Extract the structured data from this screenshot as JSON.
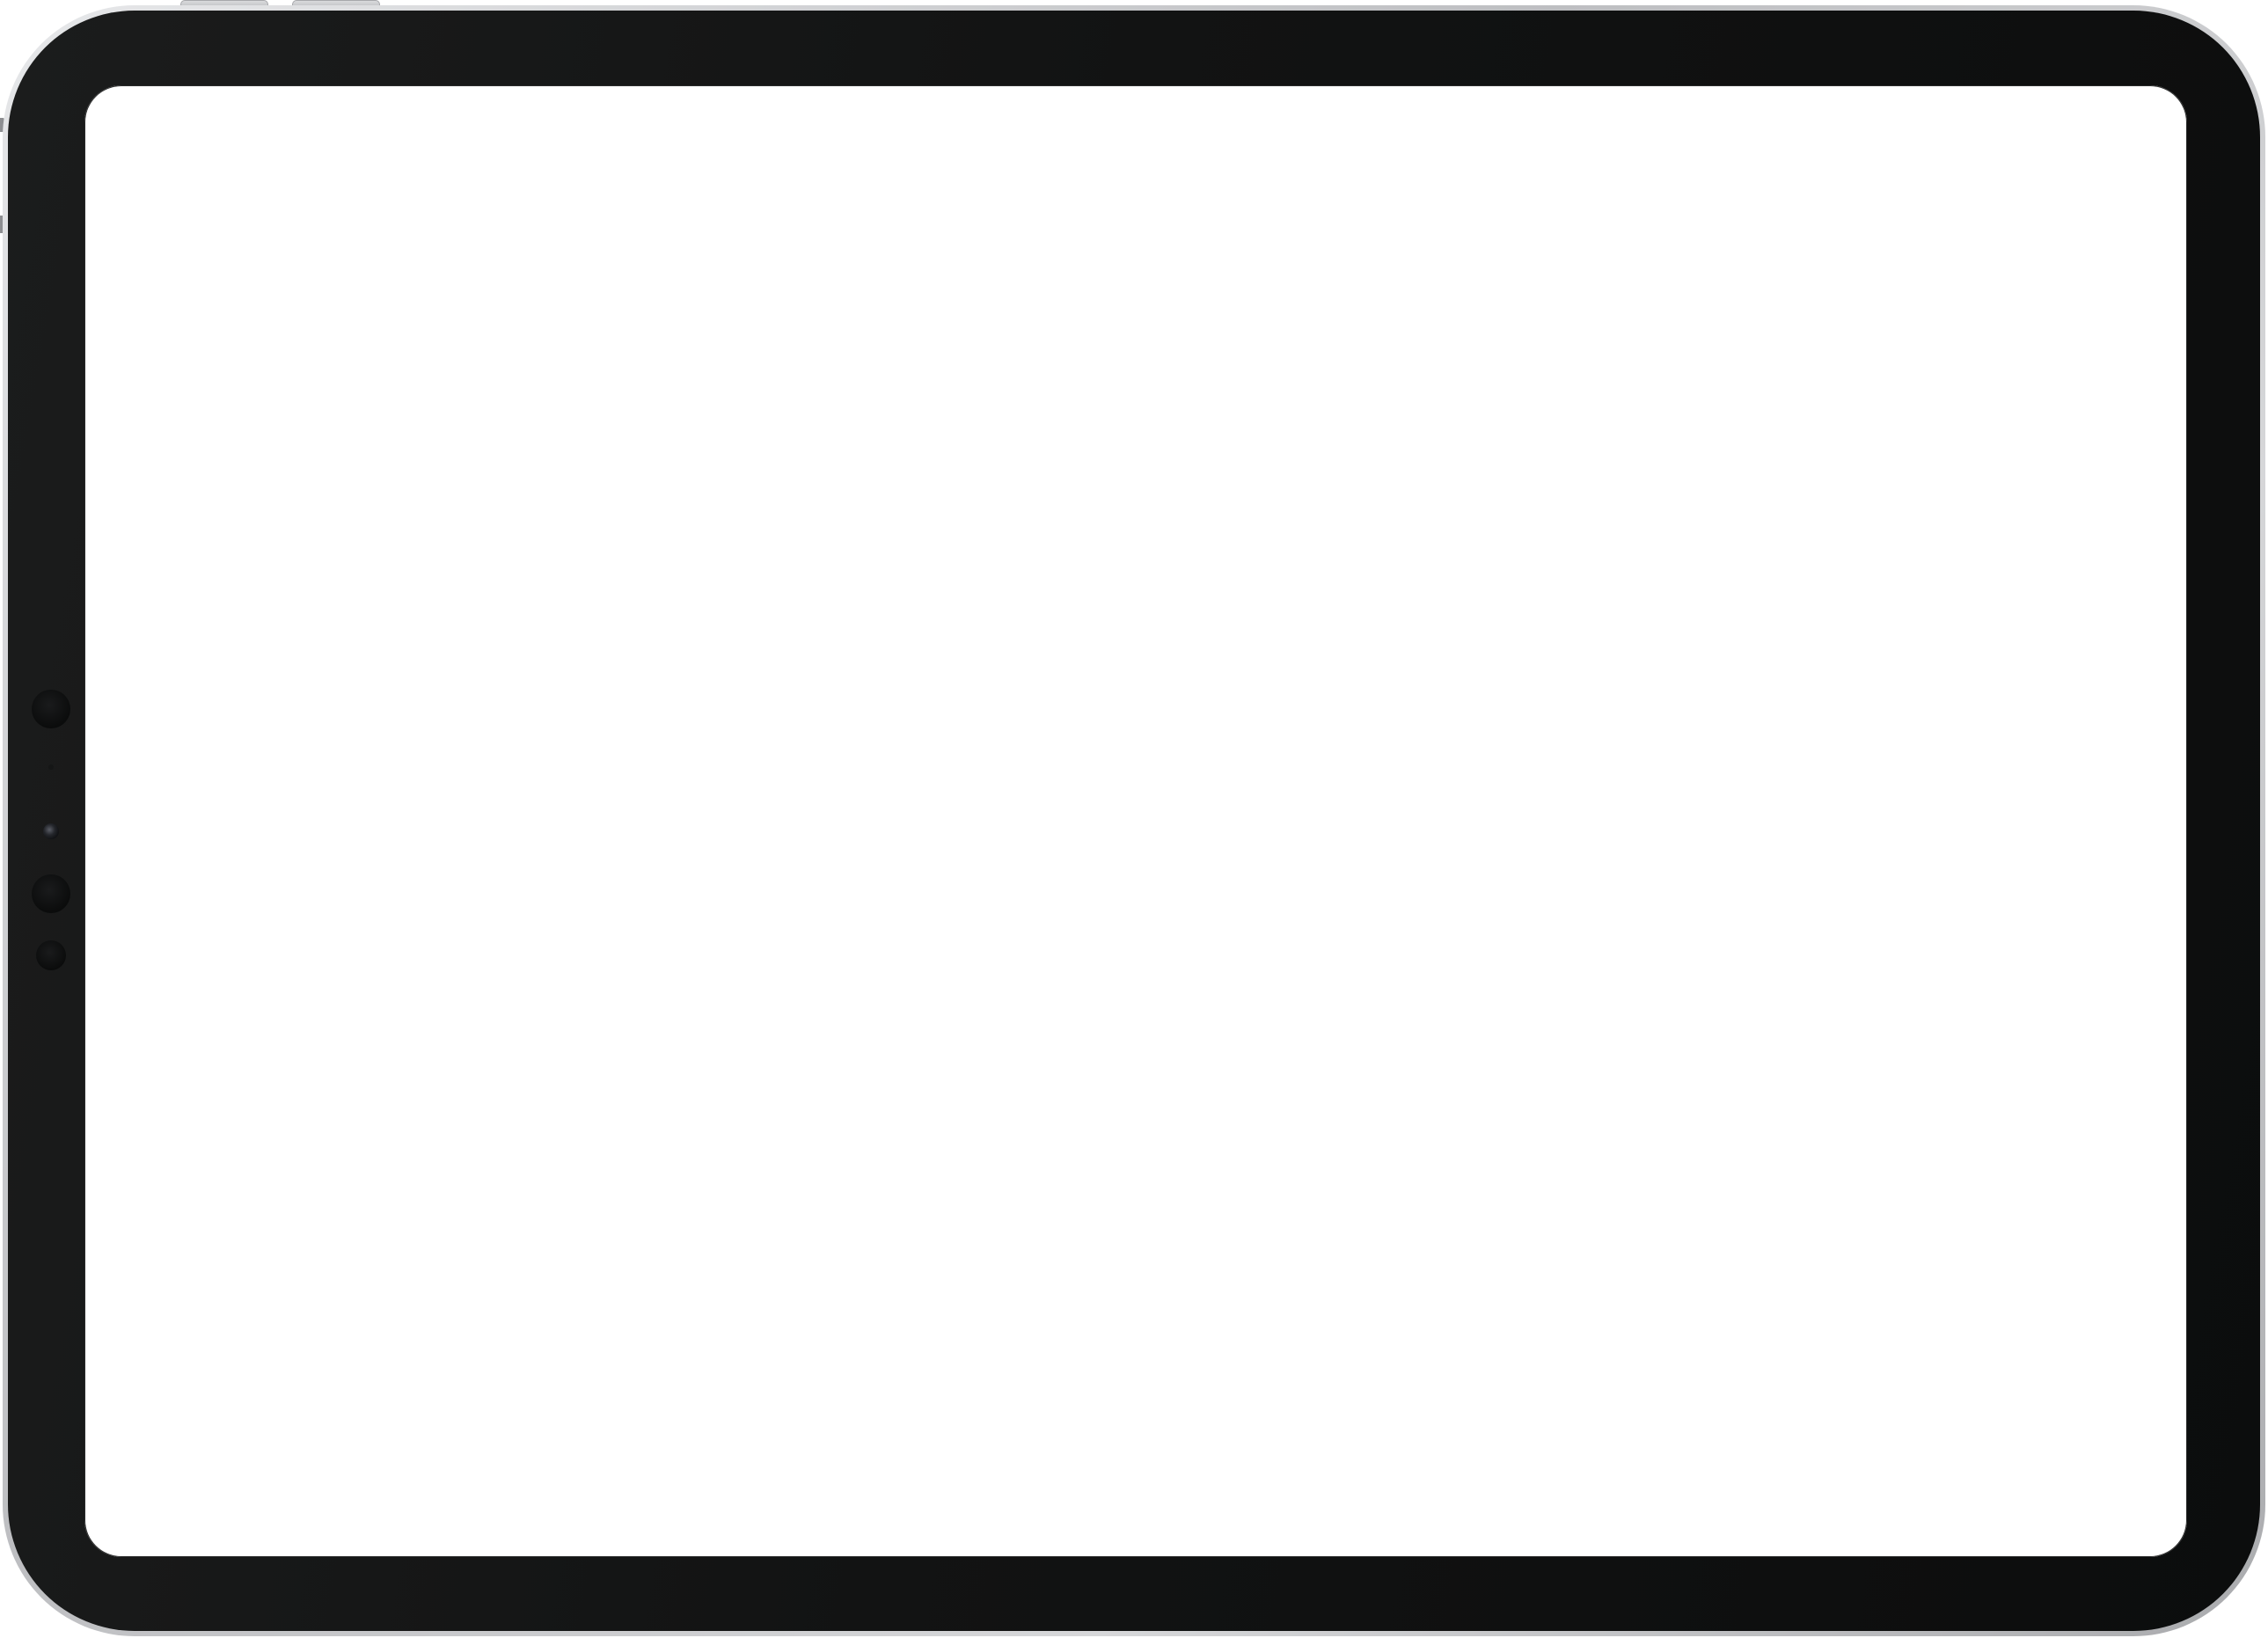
{
  "device": {
    "type": "tablet",
    "orientation": "landscape",
    "screen_state": "blank",
    "colors": {
      "rim": "#c8c9cc",
      "bezel": "#121313",
      "screen": "#ffffff"
    }
  }
}
